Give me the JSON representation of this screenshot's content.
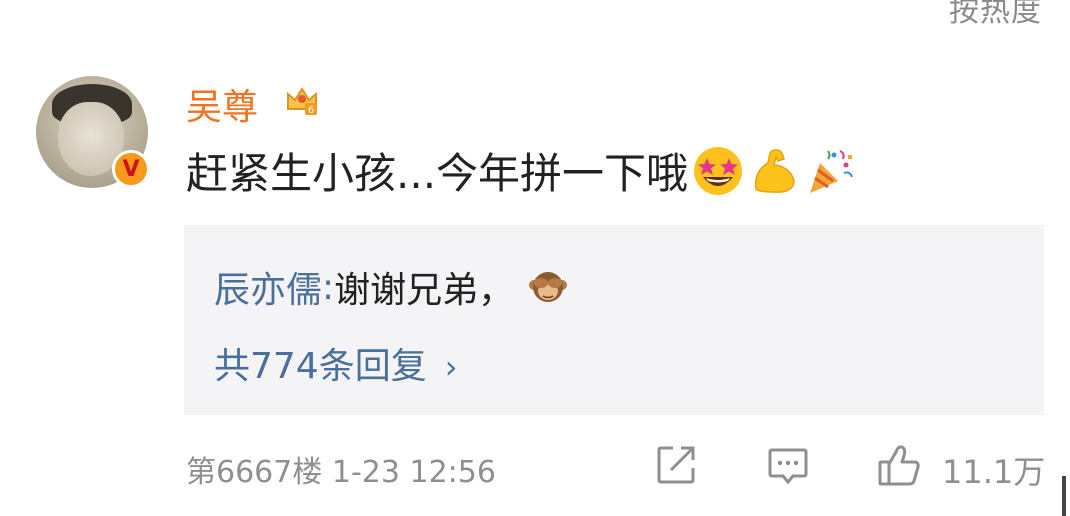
{
  "header": {
    "sort_label": "按热度"
  },
  "comment": {
    "username": "吴尊",
    "text": "赶紧生小孩...今年拼一下哦",
    "emojis": [
      "star-struck-emoji",
      "flexed-biceps-emoji",
      "party-popper-emoji"
    ],
    "verified_badge": "V",
    "level_badge": "6",
    "reply_preview": {
      "user": "辰亦儒",
      "separator": ":",
      "text": " 谢谢兄弟，",
      "emoji": "see-no-evil-monkey-emoji"
    },
    "reply_count_label": "共774条回复",
    "reply_chevron": "›",
    "floor_and_time": "第6667楼 1-23 12:56",
    "like_count": "11.1万"
  },
  "colors": {
    "username": "#f0731f",
    "link_blue": "#4a6f9d",
    "meta_gray": "#8f8f8f",
    "reply_bg": "#f4f4f6"
  }
}
